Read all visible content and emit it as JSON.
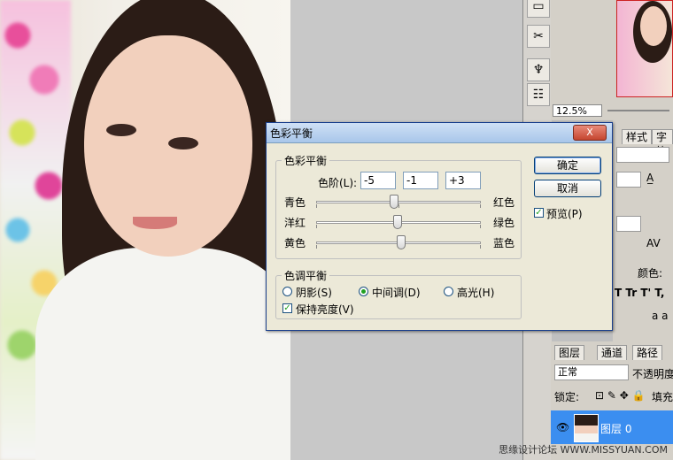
{
  "dialog": {
    "title": "色彩平衡",
    "close_label": "X",
    "color_balance_group": "色彩平衡",
    "levels_label": "色阶(L):",
    "levels": [
      "-5",
      "-1",
      "+3"
    ],
    "sliders": [
      {
        "left": "青色",
        "right": "红色",
        "value": -5
      },
      {
        "left": "洋红",
        "right": "绿色",
        "value": -1
      },
      {
        "left": "黄色",
        "right": "蓝色",
        "value": 3
      }
    ],
    "tone_group": "色调平衡",
    "tones": [
      {
        "label": "阴影(S)",
        "selected": false
      },
      {
        "label": "中间调(D)",
        "selected": true
      },
      {
        "label": "高光(H)",
        "selected": false
      }
    ],
    "preserve_luminosity": "保持亮度(V)",
    "ok_label": "确定",
    "cancel_label": "取消",
    "preview_label": "预览(P)"
  },
  "navigator": {
    "zoom": "12.5%"
  },
  "char_panel": {
    "tabs": [
      "样式",
      "字符"
    ],
    "color_label": "颜色:",
    "type_buttons": "T Tr T' T,",
    "aa_label": "a a"
  },
  "layers": {
    "tabs": [
      "图层",
      "通道",
      "路径"
    ],
    "blend_mode": "正常",
    "opacity_label": "不透明度",
    "lock_label": "锁定:",
    "fill_label": "填充",
    "layer_name": "图层 0"
  },
  "watermark": "思缘设计论坛  WWW.MISSYUAN.COM",
  "colors": {
    "title_bar": "#a8c6ea",
    "dialog_bg": "#ece9d8",
    "selected_layer": "#3b8ef0"
  }
}
